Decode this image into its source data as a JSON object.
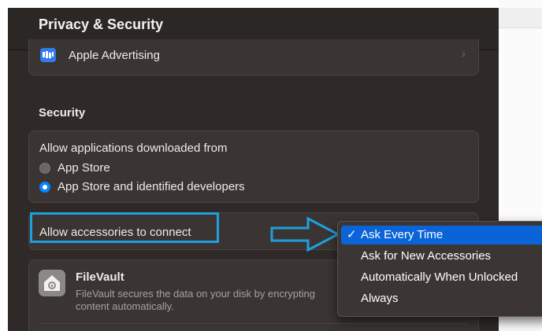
{
  "window": {
    "title": "Privacy & Security"
  },
  "advertising_row": {
    "label": "Apple Advertising",
    "icon": "apple-advertising-icon",
    "chevron": "chevron-right-icon"
  },
  "security": {
    "title": "Security",
    "allow_downloads_label": "Allow applications downloaded from",
    "options": [
      {
        "label": "App Store",
        "selected": false
      },
      {
        "label": "App Store and identified developers",
        "selected": true
      }
    ]
  },
  "accessories": {
    "label": "Allow accessories to connect",
    "selected_value": "Ask Every Time"
  },
  "menu": {
    "check": "✓",
    "items": [
      {
        "label": "Ask Every Time",
        "selected": true
      },
      {
        "label": "Ask for New Accessories",
        "selected": false
      },
      {
        "label": "Automatically When Unlocked",
        "selected": false
      },
      {
        "label": "Always",
        "selected": false
      }
    ]
  },
  "filevault": {
    "title": "FileVault",
    "description_line1": "FileVault secures the data on your disk by encrypting",
    "description_line2": "content automatically.",
    "icon": "house-lock-icon"
  },
  "colors": {
    "accent": "#0a84ff",
    "annotation": "#1ea0e0",
    "window_bg": "#2f2a27"
  }
}
